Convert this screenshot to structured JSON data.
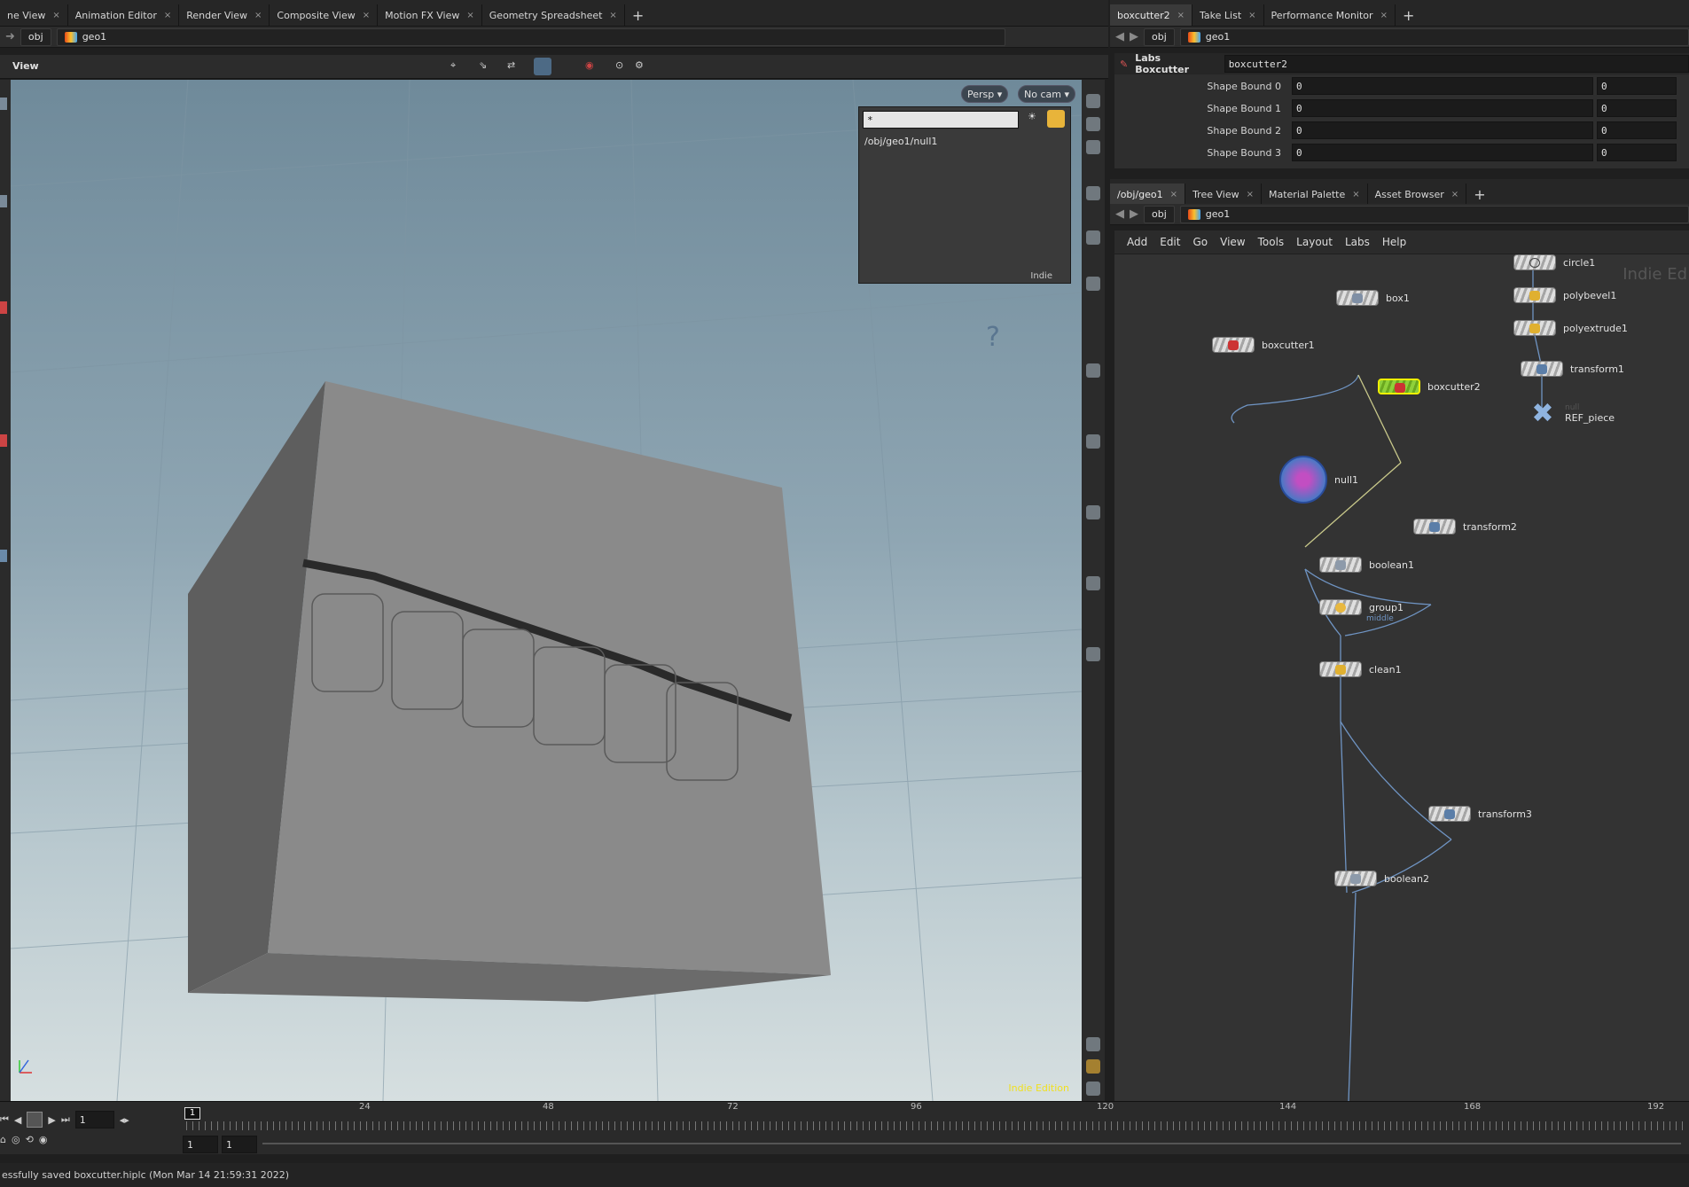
{
  "left_tabs": [
    {
      "label": "ne View"
    },
    {
      "label": "Animation Editor"
    },
    {
      "label": "Render View"
    },
    {
      "label": "Composite View"
    },
    {
      "label": "Motion FX View"
    },
    {
      "label": "Geometry Spreadsheet"
    }
  ],
  "right_top_tabs": [
    {
      "label": "boxcutter2"
    },
    {
      "label": "Take List"
    },
    {
      "label": "Performance Monitor"
    }
  ],
  "right_mid_tabs": [
    {
      "label": "/obj/geo1"
    },
    {
      "label": "Tree View"
    },
    {
      "label": "Material Palette"
    },
    {
      "label": "Asset Browser"
    }
  ],
  "path": {
    "obj": "obj",
    "geo": "geo1"
  },
  "viewport": {
    "title": "View",
    "persp": "Persp",
    "cam": "No cam",
    "edition": "Indie Edition"
  },
  "display_panel": {
    "filter": "*",
    "item": "/obj/geo1/null1",
    "badge": "Indie"
  },
  "params": {
    "node_type": "Labs Boxcutter",
    "node_name": "boxcutter2",
    "rows": [
      {
        "label": "Shape Bound 0",
        "v1": "0",
        "v2": "0"
      },
      {
        "label": "Shape Bound 1",
        "v1": "0",
        "v2": "0"
      },
      {
        "label": "Shape Bound 2",
        "v1": "0",
        "v2": "0"
      },
      {
        "label": "Shape Bound 3",
        "v1": "0",
        "v2": "0"
      }
    ]
  },
  "network_menu": [
    "Add",
    "Edit",
    "Go",
    "View",
    "Tools",
    "Layout",
    "Labs",
    "Help"
  ],
  "network_watermark": "Indie Ed",
  "nodes": {
    "circle1": "circle1",
    "polybevel1": "polybevel1",
    "polyextrude1": "polyextrude1",
    "transform1": "transform1",
    "ref_piece": "REF_piece",
    "ref_null": "null",
    "box1": "box1",
    "boxcutter1": "boxcutter1",
    "boxcutter2": "boxcutter2",
    "null1": "null1",
    "transform2": "transform2",
    "boolean1": "boolean1",
    "group1": "group1",
    "group1_sub": "middle",
    "clean1": "clean1",
    "transform3": "transform3",
    "boolean2": "boolean2"
  },
  "timeline": {
    "current_frame": "1",
    "start": "1",
    "end": "1",
    "marker": "1",
    "labels": [
      "24",
      "48",
      "72",
      "96",
      "120",
      "144",
      "168",
      "192"
    ]
  },
  "status": "essfully saved boxcutter.hiplc (Mon Mar 14 21:59:31 2022)"
}
